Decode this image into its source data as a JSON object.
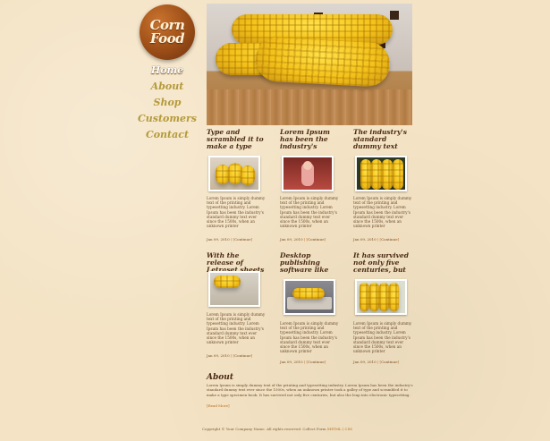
{
  "logo": {
    "line1": "Corn",
    "line2": "Food"
  },
  "nav": {
    "items": [
      "Home",
      "About",
      "Shop",
      "Customers",
      "Contact"
    ],
    "active": "Home"
  },
  "hero": {
    "alt": "corn-on-the-cob-photo"
  },
  "posts": [
    {
      "title": "Type and scrambled it to make a type",
      "text": "Lorem Ipsum is simply dummy text of the printing and typesetting industry. Lorem Ipsum has been the industry's standard dummy text ever since the 1500s, when an unknown printer",
      "date": "Jan 09, 2010",
      "link": "Continue"
    },
    {
      "title": "Lorem Ipsum has been the industry's",
      "text": "Lorem Ipsum is simply dummy text of the printing and typesetting industry. Lorem Ipsum has been the industry's standard dummy text ever since the 1500s, when an unknown printer",
      "date": "Jan 09, 2010",
      "link": "Continue"
    },
    {
      "title": "The industry's standard dummy text",
      "text": "Lorem Ipsum is simply dummy text of the printing and typesetting industry. Lorem Ipsum has been the industry's standard dummy text ever since the 1500s, when an unknown printer",
      "date": "Jan 09, 2010",
      "link": "Continue"
    },
    {
      "title": "With the release of Letraset sheets",
      "text": "Lorem Ipsum is simply dummy text of the printing and typesetting industry. Lorem Ipsum has been the industry's standard dummy text ever since the 1500s, when an unknown printer",
      "date": "Jan 09, 2010",
      "link": "Continue"
    },
    {
      "title": "Desktop publishing software like",
      "text": "Lorem Ipsum is simply dummy text of the printing and typesetting industry. Lorem Ipsum has been the industry's standard dummy text ever since the 1500s, when an unknown printer",
      "date": "Jan 09, 2010",
      "link": "Continue"
    },
    {
      "title": "It has survived not only five centuries, but",
      "text": "Lorem Ipsum is simply dummy text of the printing and typesetting industry. Lorem Ipsum has been the industry's standard dummy text ever since the 1500s, when an unknown printer",
      "date": "Jan 09, 2010",
      "link": "Continue"
    }
  ],
  "about": {
    "heading": "About",
    "text": "Lorem Ipsum is simply dummy text of the printing and typesetting industry. Lorem Ipsum has been the industry's standard dummy text ever since the 1500s, when an unknown printer took a galley of type and scrambled it to make a type specimen book. It has survived not only five centuries, but also the leap into electronic typesetting.",
    "readmore": "Read More"
  },
  "footer": {
    "text": "Copyright © Your Company Name. All rights reserved. Collect Form",
    "links": "XHTML | CSS"
  },
  "colors": {
    "accent": "#b56a20",
    "background": "#f4e3c4",
    "logo": "#9c4e17",
    "navText": "#b49a3a"
  }
}
